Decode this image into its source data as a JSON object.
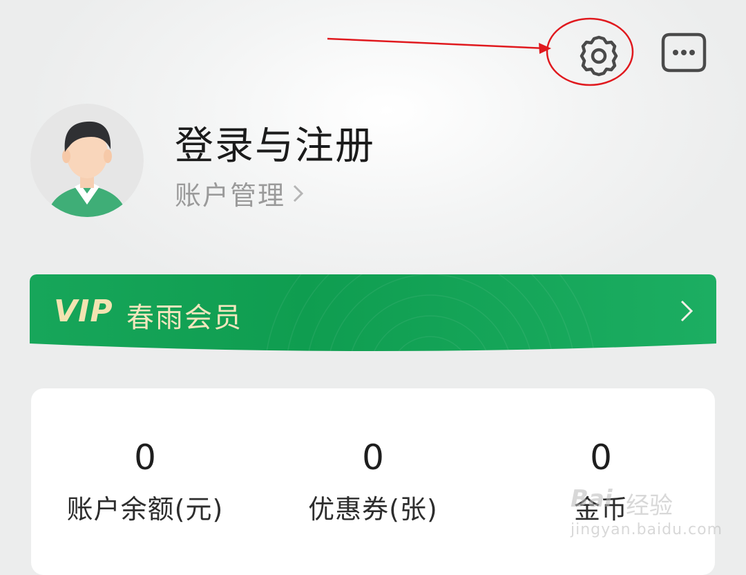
{
  "header": {
    "settings_icon": "gear-icon",
    "more_icon": "more-dots-icon",
    "annotation_color": "#e0191e"
  },
  "profile": {
    "login_title": "登录与注册",
    "account_management": "账户管理",
    "avatar_icon": "default-user-avatar"
  },
  "vip": {
    "logo": "VIP",
    "name": "春雨会员",
    "banner_color": "#13a356",
    "text_color": "#f2e6bd"
  },
  "stats": [
    {
      "value": "0",
      "label": "账户余额(元)"
    },
    {
      "value": "0",
      "label": "优惠券(张)"
    },
    {
      "value": "0",
      "label": "金币"
    }
  ],
  "watermark": {
    "logo": "Bai",
    "text": "经验",
    "url": "jingyan.baidu.com"
  }
}
